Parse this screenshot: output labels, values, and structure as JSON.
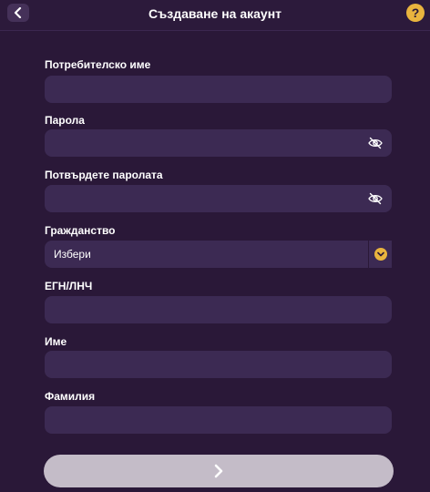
{
  "header": {
    "title": "Създаване на акаунт",
    "back_icon": "chevron-left-icon",
    "help_label": "?"
  },
  "form": {
    "username": {
      "label": "Потребителско име",
      "value": ""
    },
    "password": {
      "label": "Парола",
      "value": "",
      "icon": "eye-slash-icon"
    },
    "confirm_password": {
      "label": "Потвърдете паролата",
      "value": "",
      "icon": "eye-slash-icon"
    },
    "citizenship": {
      "label": "Гражданство",
      "selected": "Избери",
      "icon": "chevron-down-icon"
    },
    "egn": {
      "label": "ЕГН/ЛНЧ",
      "value": ""
    },
    "first_name": {
      "label": "Име",
      "value": ""
    },
    "last_name": {
      "label": "Фамилия",
      "value": ""
    }
  },
  "submit": {
    "icon": "chevron-right-icon",
    "enabled": false
  },
  "colors": {
    "background": "#2a1838",
    "field": "#3c2a53",
    "accent": "#e9b43e",
    "submit_disabled": "#c4bcc8"
  }
}
